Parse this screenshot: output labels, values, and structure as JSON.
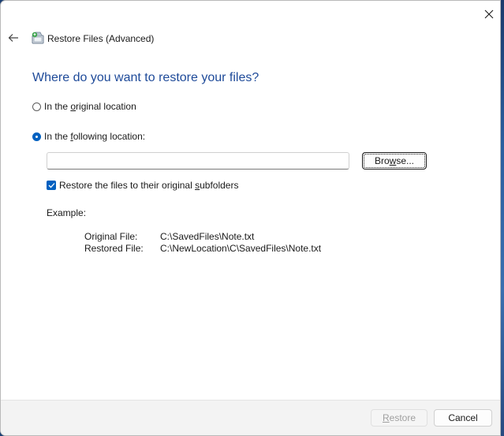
{
  "window": {
    "title": "Restore Files (Advanced)",
    "heading": "Where do you want to restore your files?"
  },
  "options": {
    "original_location": {
      "pre": "In the ",
      "key": "o",
      "post": "riginal location",
      "checked": false
    },
    "following_location": {
      "pre": "In the ",
      "key": "f",
      "post": "ollowing location:",
      "checked": true
    }
  },
  "path_input": {
    "value": "",
    "placeholder": ""
  },
  "browse_button": {
    "key": "w",
    "pre": "Bro",
    "post": "se..."
  },
  "subfolders_checkbox": {
    "pre": "Restore the files to their original ",
    "key": "s",
    "post": "ubfolders",
    "checked": true
  },
  "example": {
    "label": "Example:",
    "rows": [
      {
        "name": "Original File:",
        "value": "C:\\SavedFiles\\Note.txt"
      },
      {
        "name": "Restored File:",
        "value": "C:\\NewLocation\\C\\SavedFiles\\Note.txt"
      }
    ]
  },
  "footer": {
    "restore": {
      "key": "R",
      "post": "estore",
      "enabled": false
    },
    "cancel": {
      "label": "Cancel"
    }
  },
  "icons": [
    "close-icon",
    "back-arrow-icon",
    "restore-files-icon",
    "checkmark-icon"
  ],
  "colors": {
    "accent": "#0060c0",
    "heading": "#1e4a99",
    "background": "#1b3f73"
  }
}
